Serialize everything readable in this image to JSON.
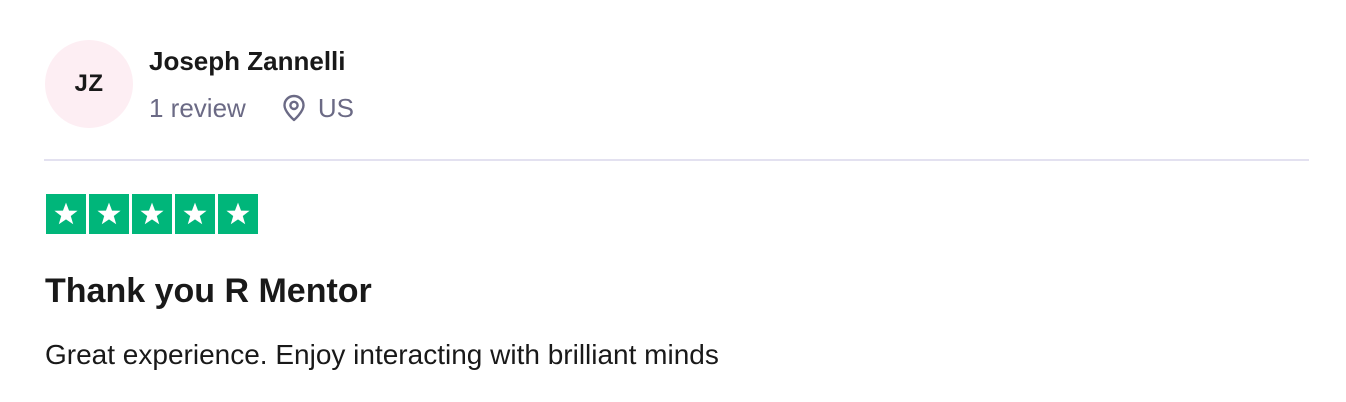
{
  "reviewer": {
    "initials": "JZ",
    "name": "Joseph Zannelli",
    "review_count": "1 review",
    "location_icon": "location-pin-icon",
    "country": "US",
    "avatar_bg": "#fdeef3"
  },
  "rating": {
    "stars": 5,
    "max_stars": 5,
    "star_color": "#00b67a",
    "star_icon": "star-icon"
  },
  "review": {
    "title": "Thank you R Mentor",
    "body": "Great experience. Enjoy interacting with brilliant minds"
  }
}
